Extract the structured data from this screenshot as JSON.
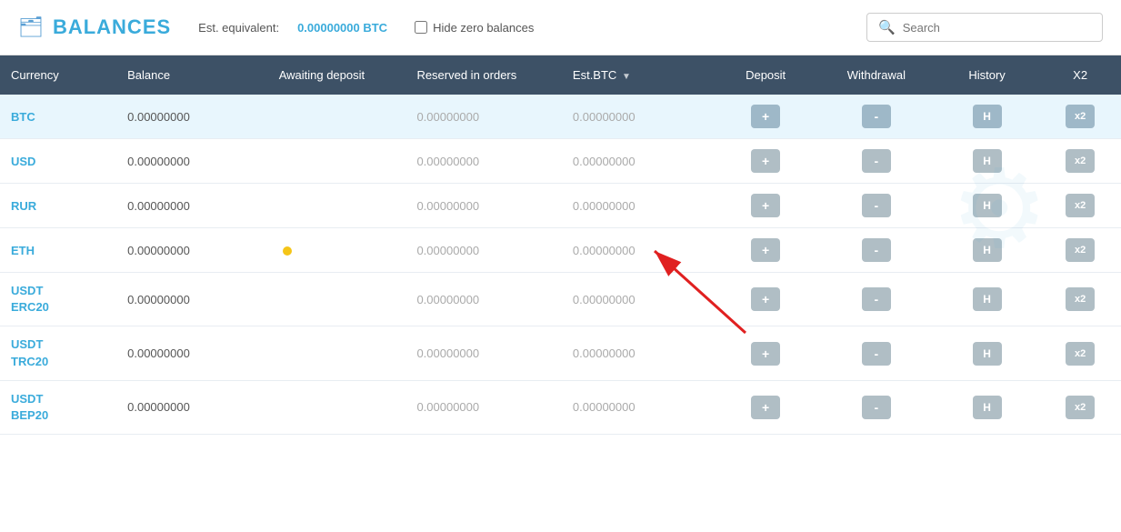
{
  "header": {
    "title": "BALANCES",
    "wallet_icon": "💼",
    "est_label": "Est. equivalent:",
    "est_value": "0.00000000 BTC",
    "hide_zero_label": "Hide zero balances",
    "search_placeholder": "Search"
  },
  "table": {
    "columns": [
      {
        "key": "currency",
        "label": "Currency"
      },
      {
        "key": "balance",
        "label": "Balance"
      },
      {
        "key": "awaiting",
        "label": "Awaiting deposit"
      },
      {
        "key": "reserved",
        "label": "Reserved in orders"
      },
      {
        "key": "estbtc",
        "label": "Est.BTC",
        "sortable": true
      },
      {
        "key": "deposit",
        "label": "Deposit"
      },
      {
        "key": "withdrawal",
        "label": "Withdrawal"
      },
      {
        "key": "history",
        "label": "History"
      },
      {
        "key": "x2",
        "label": "X2"
      }
    ],
    "rows": [
      {
        "currency": "BTC",
        "balance": "0.00000000",
        "awaiting": "",
        "reserved": "0.00000000",
        "estbtc": "0.00000000",
        "highlighted": true
      },
      {
        "currency": "USD",
        "balance": "0.00000000",
        "awaiting": "",
        "reserved": "0.00000000",
        "estbtc": "0.00000000",
        "highlighted": false
      },
      {
        "currency": "RUR",
        "balance": "0.00000000",
        "awaiting": "",
        "reserved": "0.00000000",
        "estbtc": "0.00000000",
        "highlighted": false
      },
      {
        "currency": "ETH",
        "balance": "0.00000000",
        "awaiting": "",
        "reserved": "0.00000000",
        "estbtc": "0.00000000",
        "highlighted": false,
        "eth_dot": true
      },
      {
        "currency": "USDT\nERC20",
        "balance": "0.00000000",
        "awaiting": "",
        "reserved": "0.00000000",
        "estbtc": "0.00000000",
        "highlighted": false,
        "multiline": true
      },
      {
        "currency": "USDT\nTRC20",
        "balance": "0.00000000",
        "awaiting": "",
        "reserved": "0.00000000",
        "estbtc": "0.00000000",
        "highlighted": false,
        "multiline": true
      },
      {
        "currency": "USDT\nBEP20",
        "balance": "0.00000000",
        "awaiting": "",
        "reserved": "0.00000000",
        "estbtc": "0.00000000",
        "highlighted": false,
        "multiline": true
      }
    ],
    "btn_deposit": "+",
    "btn_withdraw": "-",
    "btn_history": "H",
    "btn_x2": "x2"
  }
}
